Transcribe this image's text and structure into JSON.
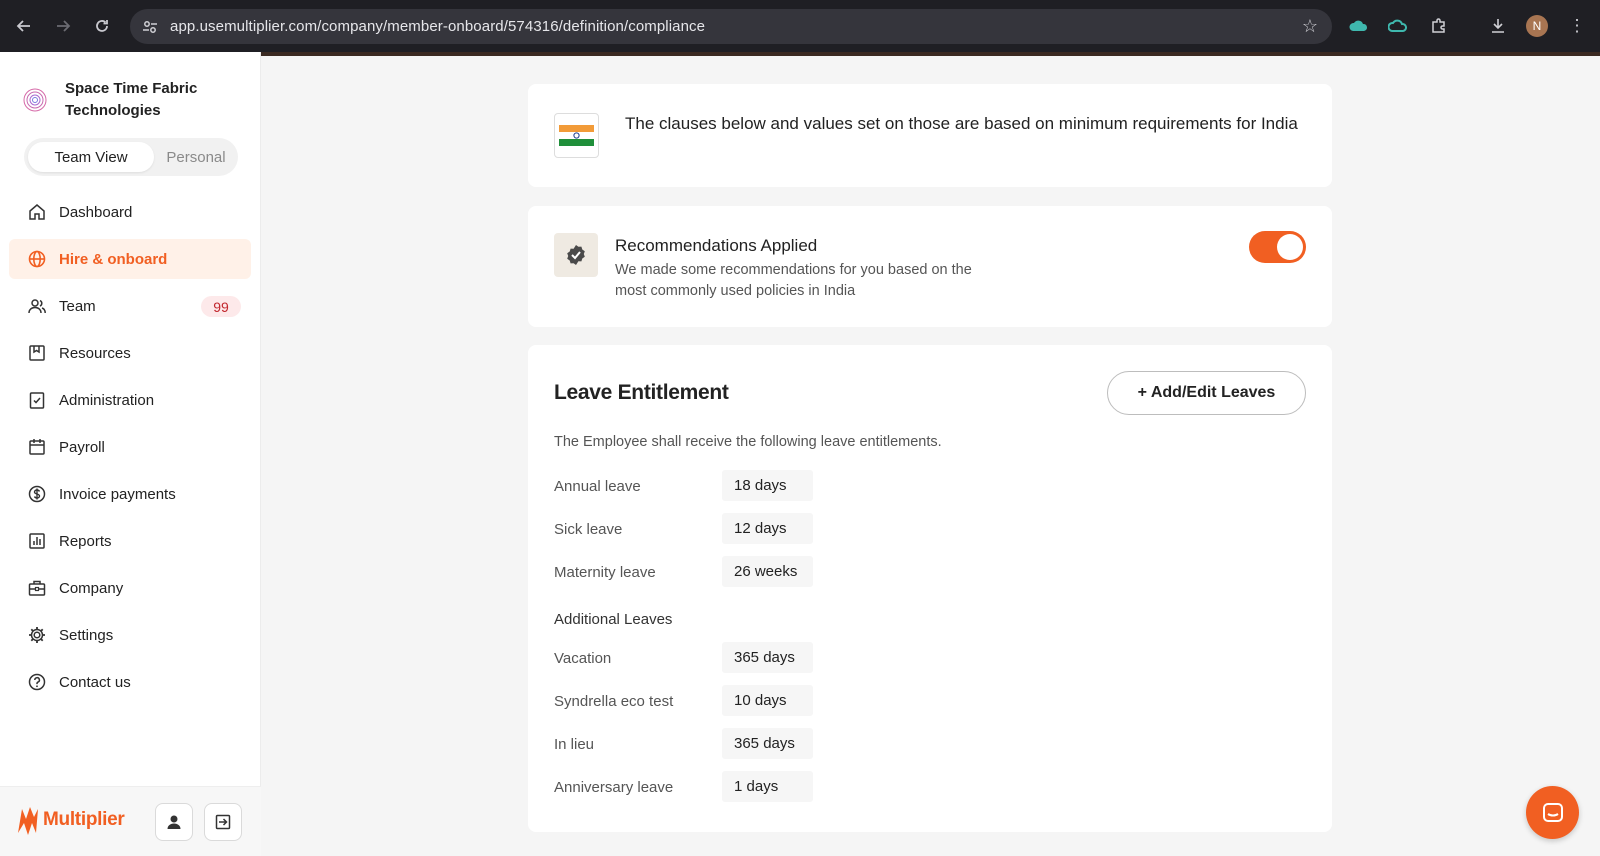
{
  "browser": {
    "url": "app.usemultiplier.com/company/member-onboard/574316/definition/compliance",
    "profile_initial": "N",
    "icons": [
      "back-icon",
      "forward-icon",
      "reload-icon",
      "site-info-icon",
      "bookmark-star-icon",
      "cloud-extension-icon",
      "cloud-extension-icon",
      "extensions-puzzle-icon",
      "download-icon",
      "profile-avatar",
      "more-menu-icon"
    ]
  },
  "sidebar": {
    "company_name": "Space Time Fabric Technologies",
    "view_toggle": {
      "team": "Team View",
      "personal": "Personal"
    },
    "items": [
      {
        "label": "Dashboard",
        "icon": "home-icon"
      },
      {
        "label": "Hire & onboard",
        "icon": "globe-icon",
        "active": true
      },
      {
        "label": "Team",
        "icon": "users-icon",
        "badge": "99"
      },
      {
        "label": "Resources",
        "icon": "book-icon"
      },
      {
        "label": "Administration",
        "icon": "clipboard-check-icon"
      },
      {
        "label": "Payroll",
        "icon": "calendar-icon"
      },
      {
        "label": "Invoice payments",
        "icon": "dollar-circle-icon"
      },
      {
        "label": "Reports",
        "icon": "bar-chart-icon"
      },
      {
        "label": "Company",
        "icon": "briefcase-icon"
      },
      {
        "label": "Settings",
        "icon": "gear-icon"
      },
      {
        "label": "Contact us",
        "icon": "help-circle-icon"
      }
    ],
    "brand": "Multiplier"
  },
  "main": {
    "country_notice": "The clauses below and values set on those are based on minimum requirements for India",
    "recommendations": {
      "title": "Recommendations Applied",
      "description": "We made some recommendations for you based on the most commonly used policies in India",
      "enabled": true
    },
    "leave": {
      "title": "Leave Entitlement",
      "edit_button": "+ Add/Edit Leaves",
      "description": "The Employee shall receive the following leave entitlements.",
      "standard": [
        {
          "label": "Annual leave",
          "value": "18 days"
        },
        {
          "label": "Sick leave",
          "value": "12 days"
        },
        {
          "label": "Maternity leave",
          "value": "26 weeks"
        }
      ],
      "additional_title": "Additional Leaves",
      "additional": [
        {
          "label": "Vacation",
          "value": "365 days"
        },
        {
          "label": "Syndrella eco test",
          "value": "10 days"
        },
        {
          "label": "In lieu",
          "value": "365 days"
        },
        {
          "label": "Anniversary leave",
          "value": "1 days"
        }
      ]
    }
  },
  "colors": {
    "accent": "#f15f22",
    "badge_bg": "#fde9ea",
    "badge_text": "#c2272d"
  }
}
